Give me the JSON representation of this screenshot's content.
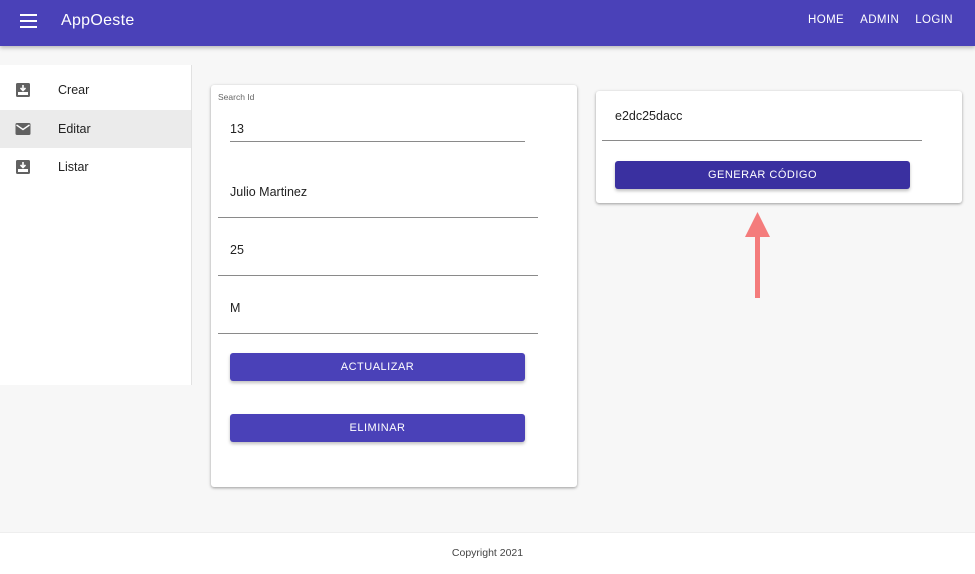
{
  "header": {
    "app_title": "AppOeste",
    "nav": {
      "home": "HOME",
      "admin": "ADMIN",
      "login": "LOGIN"
    }
  },
  "sidebar": {
    "items": [
      {
        "label": "Crear",
        "icon": "inbox-download-icon"
      },
      {
        "label": "Editar",
        "icon": "mail-icon",
        "active": true
      },
      {
        "label": "Listar",
        "icon": "inbox-download-icon"
      }
    ]
  },
  "edit_form": {
    "search_label": "Search Id",
    "search_value": "13",
    "name_value": "Julio Martinez",
    "age_value": "25",
    "gender_value": "M",
    "update_label": "ACTUALIZAR",
    "delete_label": "ELIMINAR"
  },
  "code_card": {
    "code_value": "e2dc25dacc",
    "generate_label": "GENERAR CÓDIGO"
  },
  "footer": {
    "text": "Copyright 2021"
  },
  "colors": {
    "primary": "#4a41b8",
    "annotation_arrow": "#f47c7c"
  }
}
